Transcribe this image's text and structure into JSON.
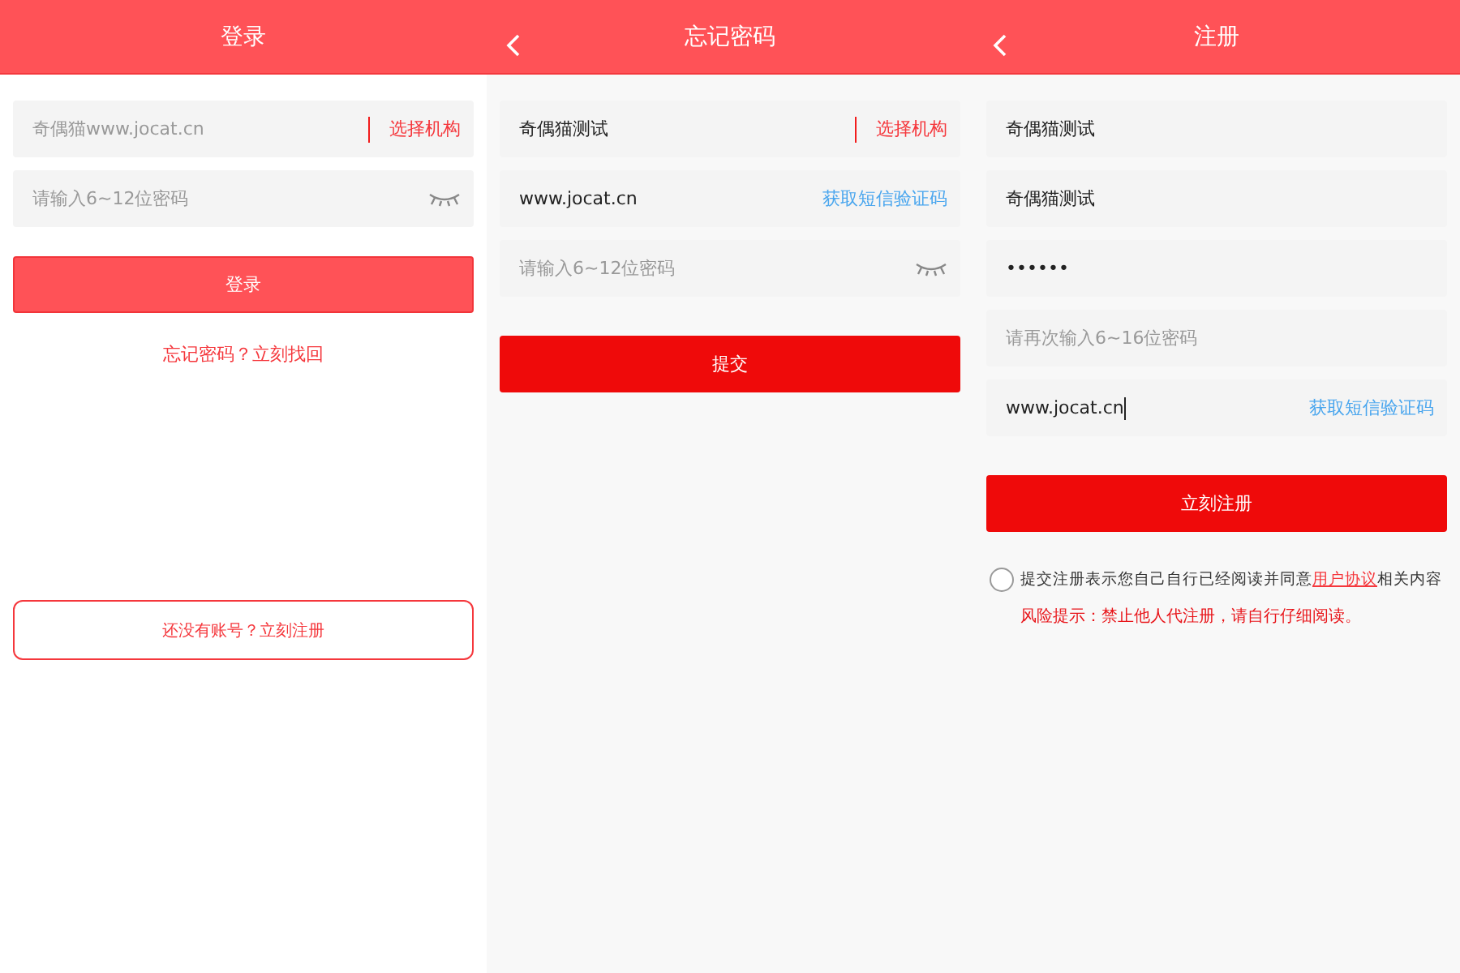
{
  "screens": [
    {
      "title": "登录",
      "back": false,
      "fields": [
        {
          "placeholder": "奇偶猫www.jocat.cn",
          "kind": "select",
          "action": "选择机构"
        },
        {
          "placeholder": "请输入6~12位密码",
          "kind": "eye"
        }
      ],
      "submit": {
        "label": "登录"
      },
      "forgot_link": "忘记密码？立刻找回",
      "register_button": "还没有账号？立刻注册"
    },
    {
      "title": "忘记密码",
      "back": true,
      "fields": [
        {
          "value": "奇偶猫测试",
          "kind": "select",
          "action": "选择机构"
        },
        {
          "value": "www.jocat.cn",
          "kind": "sms",
          "action": "获取短信验证码"
        },
        {
          "placeholder": "请输入6~12位密码",
          "kind": "eye"
        }
      ],
      "submit": {
        "label": "提交"
      }
    },
    {
      "title": "注册",
      "back": true,
      "fields": [
        {
          "value": "奇偶猫测试",
          "kind": "plain"
        },
        {
          "value": "奇偶猫测试",
          "kind": "plain"
        },
        {
          "value": "••••••",
          "kind": "plain"
        },
        {
          "placeholder": "请再次输入6~16位密码",
          "kind": "plain"
        },
        {
          "value": "www.jocat.cn",
          "kind": "sms",
          "action": "获取短信验证码",
          "focused": true
        }
      ],
      "submit": {
        "label": "立刻注册"
      },
      "agreement": {
        "checked": false,
        "before": "提交注册表示您自己自行已经阅读并同意",
        "link": "用户协议",
        "after": "相关内容"
      },
      "risk_notice": "风险提示：禁止他人代注册，请自行仔细阅读。"
    }
  ]
}
